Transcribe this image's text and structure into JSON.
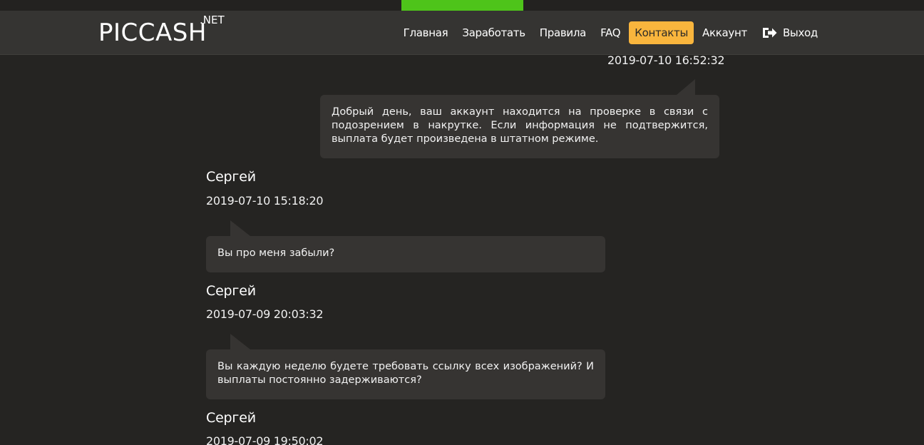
{
  "site": {
    "logo_text": "PICCASH",
    "logo_sup": ".NET",
    "accent_green": "#4ec41a",
    "accent_active": "#f9b53d"
  },
  "nav": {
    "items": [
      {
        "label": "Главная"
      },
      {
        "label": "Заработать"
      },
      {
        "label": "Правила"
      },
      {
        "label": "FAQ"
      },
      {
        "label": "Контакты",
        "active": true
      },
      {
        "label": "Аккаунт"
      }
    ],
    "exit_label": "Выход",
    "exit_icon": "sign-out-icon"
  },
  "messages": [
    {
      "timestamp": "2019-07-10 16:52:32",
      "side": "right",
      "text": "Добрый день, ваш аккаунт находится на проверке в связи с подозрением в накрутке. Если информация не подтвержится, выплата будет произведена в штатном режиме."
    },
    {
      "author": "Сергей",
      "timestamp": "2019-07-10 15:18:20",
      "side": "left",
      "text": "Вы про меня забыли?"
    },
    {
      "author": "Сергей",
      "timestamp": "2019-07-09 20:03:32",
      "side": "left",
      "text": "Вы каждую неделю будете требовать ссылку всех изображений? И выплаты постоянно задерживаются?"
    },
    {
      "author": "Сергей",
      "timestamp": "2019-07-09 19:50:02"
    }
  ]
}
